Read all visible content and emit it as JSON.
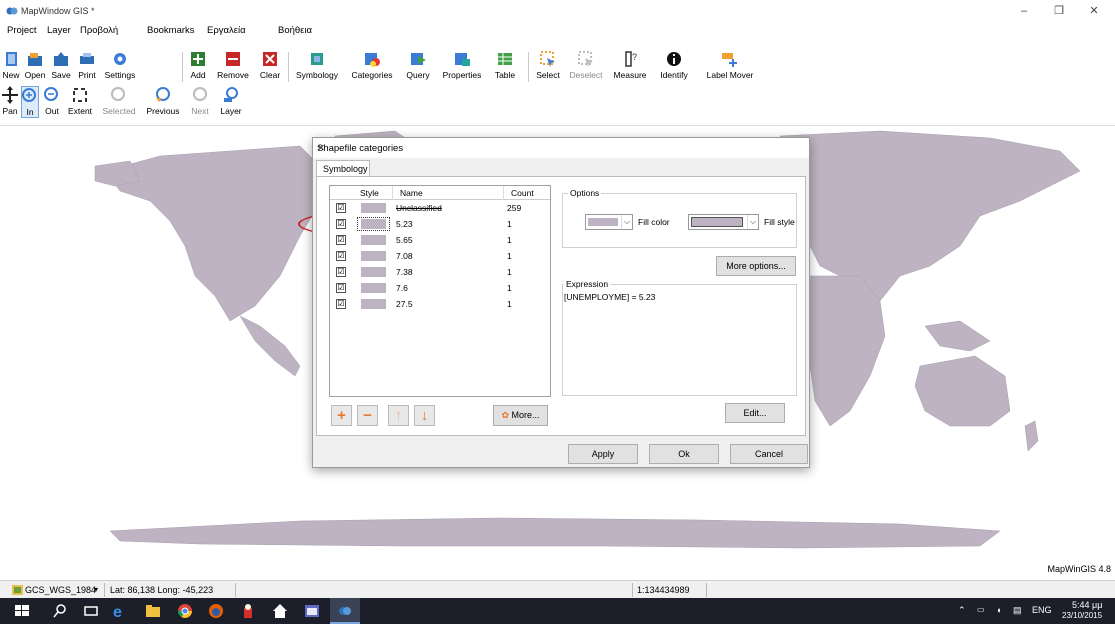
{
  "window": {
    "title": "MapWindow GIS *",
    "minimize": "–",
    "restore": "❐",
    "close": "✕"
  },
  "menu": [
    "Project",
    "Layer",
    "Προβολή",
    "Bookmarks",
    "Εργαλεία",
    "Βοήθεια"
  ],
  "toolbar1": {
    "new": "New",
    "open": "Open",
    "save": "Save",
    "print": "Print",
    "settings": "Settings",
    "add": "Add",
    "remove": "Remove",
    "clear": "Clear",
    "symbology": "Symbology",
    "categories": "Categories",
    "query": "Query",
    "properties": "Properties",
    "table": "Table",
    "select": "Select",
    "deselect": "Deselect",
    "measure": "Measure",
    "identify": "Identify",
    "label_mover": "Label Mover"
  },
  "toolbar2": {
    "pan": "Pan",
    "in": "In",
    "out": "Out",
    "extent": "Extent",
    "selected": "Selected",
    "previous": "Previous",
    "next": "Next",
    "layer": "Layer"
  },
  "colors": {
    "land": "#bdb3c2",
    "accent": "#e8782b",
    "ellipse": "#d02020"
  },
  "dialog": {
    "title": "Shapefile categories",
    "close": "✕",
    "tab": "Symbology",
    "grid": {
      "headers": {
        "style": "Style",
        "name": "Name",
        "count": "Count"
      },
      "rows": [
        {
          "checked": "☑",
          "name": "Unclassified",
          "count": "259"
        },
        {
          "checked": "☑",
          "name": "5.23",
          "count": "1"
        },
        {
          "checked": "☑",
          "name": "5.65",
          "count": "1"
        },
        {
          "checked": "☑",
          "name": "7.08",
          "count": "1"
        },
        {
          "checked": "☑",
          "name": "7.38",
          "count": "1"
        },
        {
          "checked": "☑",
          "name": "7.6",
          "count": "1"
        },
        {
          "checked": "☑",
          "name": "27.5",
          "count": "1"
        }
      ]
    },
    "add": "+",
    "remove": "−",
    "up": "↑",
    "down": "↓",
    "more": "More...",
    "options_title": "Options",
    "fill_color": "Fill color",
    "fill_style": "Fill style",
    "more_options": "More options...",
    "expression_title": "Expression",
    "expression": "[UNEMPLOYME] = 5.23",
    "edit": "Edit...",
    "apply": "Apply",
    "ok": "Ok",
    "cancel": "Cancel"
  },
  "map": {
    "brand": "MapWinGIS 4.8"
  },
  "statusbar": {
    "projection": "GCS_WGS_1984",
    "coords": "Lat: 86,138 Long: -45,223",
    "scale": "1:134434989"
  },
  "taskbar": {
    "lang": "ENG",
    "time": "5:44 μμ",
    "date": "23/10/2015"
  }
}
